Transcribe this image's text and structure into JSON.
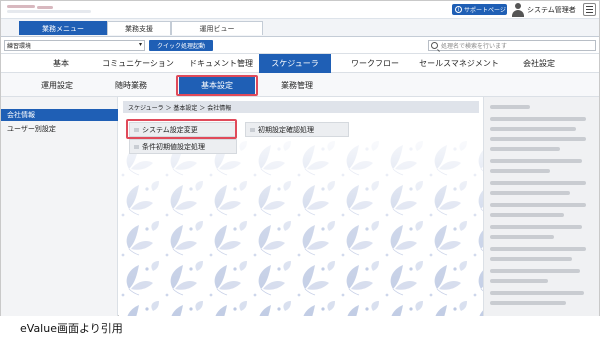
{
  "header": {
    "support_label": "サポートページ",
    "user_name": "システム管理者"
  },
  "menubar": {
    "tabs": [
      {
        "label": "業務メニュー",
        "active": true
      },
      {
        "label": "業務支援",
        "active": false
      },
      {
        "label": "運用ビュー",
        "active": false
      }
    ]
  },
  "toolbar": {
    "select_value": "練習環境",
    "quick_button": "クイック処理起動",
    "search_placeholder": "処理名で検索を行います"
  },
  "modules": [
    {
      "label": "基本",
      "active": false
    },
    {
      "label": "コミュニケーション",
      "active": false
    },
    {
      "label": "ドキュメント管理",
      "active": false
    },
    {
      "label": "スケジューラ",
      "active": true
    },
    {
      "label": "ワークフロー",
      "active": false
    },
    {
      "label": "セールスマネジメント",
      "active": false
    },
    {
      "label": "会社設定",
      "active": false
    }
  ],
  "subtabs": [
    {
      "label": "運用設定",
      "active": false
    },
    {
      "label": "随時業務",
      "active": false
    },
    {
      "label": "基本設定",
      "active": true
    },
    {
      "label": "業務管理",
      "active": false
    }
  ],
  "sidebar": {
    "items": [
      {
        "label": "会社情報",
        "active": true
      },
      {
        "label": "ユーザー別設定",
        "active": false
      }
    ]
  },
  "main": {
    "breadcrumb": "スケジューラ ＞ 基本設定 ＞ 会社情報",
    "buttons": [
      {
        "label": "システム設定変更"
      },
      {
        "label": "初期設定確認処理"
      },
      {
        "label": "条件初期値設定処理"
      }
    ]
  },
  "colors": {
    "accent": "#1f5fb5",
    "highlight": "#e04a5a"
  },
  "caption": "eValue画面より引用"
}
